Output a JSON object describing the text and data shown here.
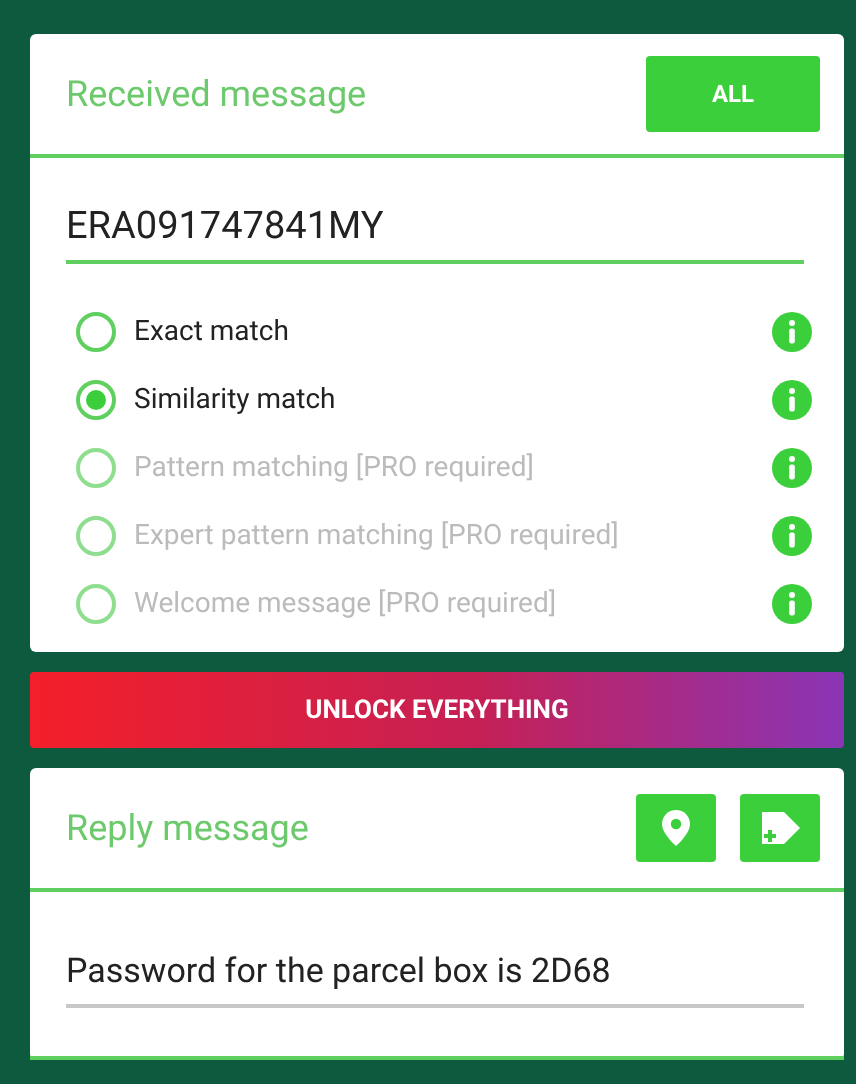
{
  "received": {
    "title": "Received message",
    "all_button": "ALL",
    "value": "ERA091747841MY",
    "options": [
      {
        "label": "Exact match",
        "selected": false,
        "disabled": false
      },
      {
        "label": "Similarity match",
        "selected": true,
        "disabled": false
      },
      {
        "label": "Pattern matching [PRO required]",
        "selected": false,
        "disabled": true
      },
      {
        "label": "Expert pattern matching [PRO required]",
        "selected": false,
        "disabled": true
      },
      {
        "label": "Welcome message [PRO required]",
        "selected": false,
        "disabled": true
      }
    ]
  },
  "unlock_button": "UNLOCK EVERYTHING",
  "reply": {
    "title": "Reply message",
    "value": "Password for the parcel box is 2D68"
  }
}
